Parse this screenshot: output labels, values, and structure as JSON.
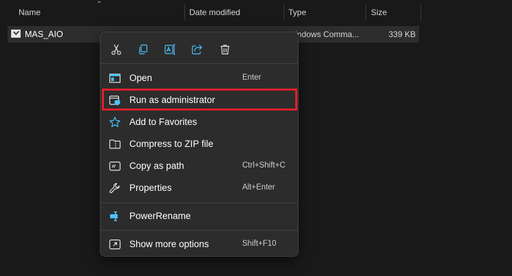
{
  "columns": {
    "name": "Name",
    "date_modified": "Date modified",
    "type": "Type",
    "size": "Size"
  },
  "file": {
    "name": "MAS_AIO",
    "type_partial": "indows Comma...",
    "size": "339 KB"
  },
  "quick_actions": [
    "cut-icon",
    "copy-icon",
    "rename-icon",
    "share-icon",
    "delete-icon"
  ],
  "menu": {
    "open": {
      "label": "Open",
      "shortcut": "Enter"
    },
    "run_as_admin": {
      "label": "Run as administrator"
    },
    "add_favorites": {
      "label": "Add to Favorites"
    },
    "compress_zip": {
      "label": "Compress to ZIP file"
    },
    "copy_path": {
      "label": "Copy as path",
      "shortcut": "Ctrl+Shift+C"
    },
    "properties": {
      "label": "Properties",
      "shortcut": "Alt+Enter"
    },
    "power_rename": {
      "label": "PowerRename"
    },
    "show_more": {
      "label": "Show more options",
      "shortcut": "Shift+F10"
    }
  },
  "colors": {
    "accent": "#4cc2ff",
    "highlight_outline": "#e41e2b",
    "menu_bg": "#2c2c2c",
    "window_bg": "#191919"
  }
}
